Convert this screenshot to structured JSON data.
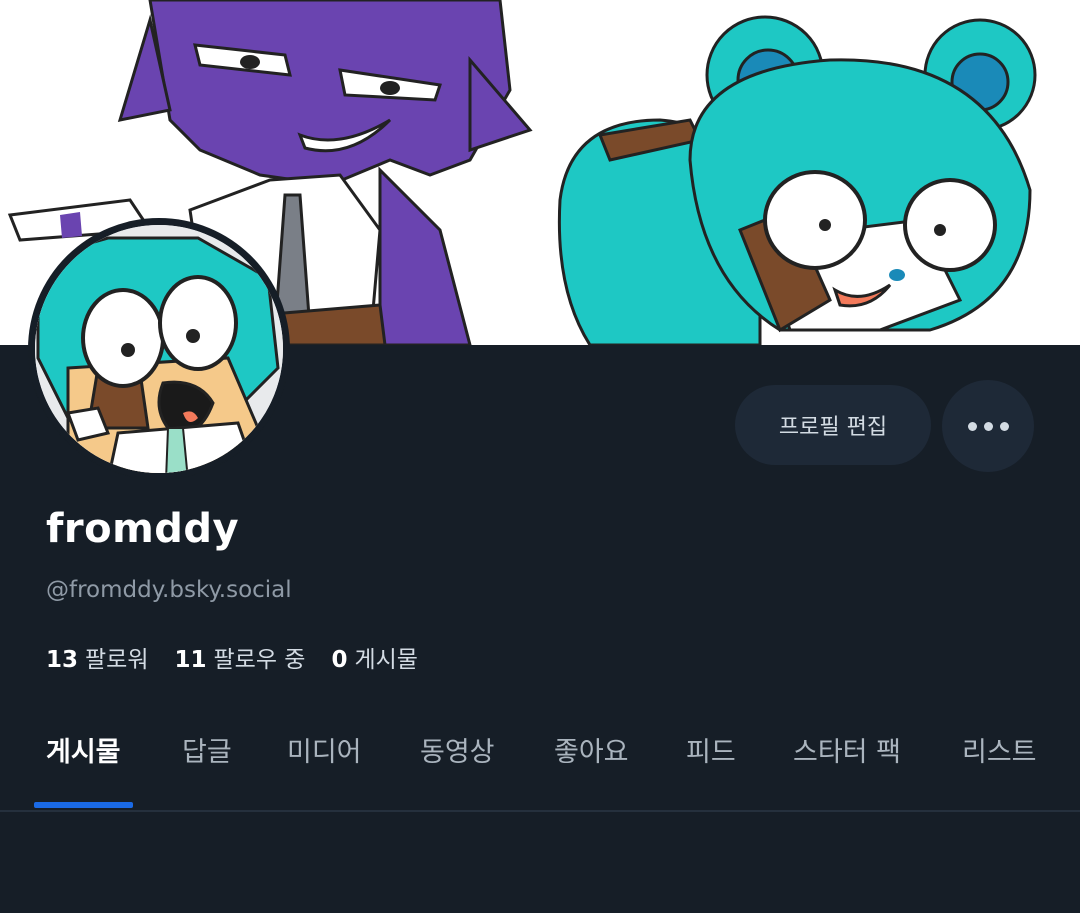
{
  "profile": {
    "display_name": "fromddy",
    "handle": "@fromddy.bsky.social"
  },
  "actions": {
    "edit_profile_label": "프로필 편집",
    "more_icon": "ellipsis-icon"
  },
  "stats": {
    "followers_count": "13",
    "followers_label": "팔로워",
    "following_count": "11",
    "following_label": "팔로우 중",
    "posts_count": "0",
    "posts_label": "게시물"
  },
  "tabs": [
    {
      "label": "게시물",
      "active": true
    },
    {
      "label": "답글",
      "active": false
    },
    {
      "label": "미디어",
      "active": false
    },
    {
      "label": "동영상",
      "active": false
    },
    {
      "label": "좋아요",
      "active": false
    },
    {
      "label": "피드",
      "active": false
    },
    {
      "label": "스타터 팩",
      "active": false
    },
    {
      "label": "리스트",
      "active": false
    }
  ],
  "colors": {
    "background": "#161e27",
    "accent": "#1a6ae6",
    "button_bg": "#1e2937",
    "handle_text": "#8f9aa6"
  }
}
